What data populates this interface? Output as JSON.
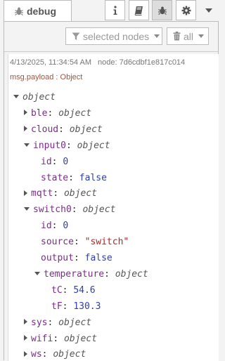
{
  "header": {
    "tab_label": "debug",
    "tab_icon": "bug-icon",
    "buttons": [
      {
        "name": "info-icon"
      },
      {
        "name": "book-icon"
      },
      {
        "name": "bug-icon",
        "active": true
      },
      {
        "name": "gear-icon"
      }
    ]
  },
  "toolbar": {
    "filter_label": "selected nodes",
    "clear_label": "all"
  },
  "message": {
    "timestamp": "4/13/2025, 11:34:54 AM",
    "node": "node: 7d6cdbf1e817c014",
    "topic": "msg.payload : Object",
    "tree": [
      {
        "key": "object",
        "expanded": true
      },
      {
        "key": "ble",
        "type": "object",
        "expanded": false
      },
      {
        "key": "cloud",
        "type": "object",
        "expanded": false
      },
      {
        "key": "input0",
        "type": "object",
        "expanded": true
      },
      {
        "key": "id",
        "value": "0",
        "kind": "num"
      },
      {
        "key": "state",
        "value": "false",
        "kind": "bool"
      },
      {
        "key": "mqtt",
        "type": "object",
        "expanded": false
      },
      {
        "key": "switch0",
        "type": "object",
        "expanded": true
      },
      {
        "key": "id",
        "value": "0",
        "kind": "num"
      },
      {
        "key": "source",
        "value": "\"switch\"",
        "kind": "str"
      },
      {
        "key": "output",
        "value": "false",
        "kind": "bool"
      },
      {
        "key": "temperature",
        "type": "object",
        "expanded": true
      },
      {
        "key": "tC",
        "value": "54.6",
        "kind": "num"
      },
      {
        "key": "tF",
        "value": "130.3",
        "kind": "num"
      },
      {
        "key": "sys",
        "type": "object",
        "expanded": false
      },
      {
        "key": "wifi",
        "type": "object",
        "expanded": false
      },
      {
        "key": "ws",
        "type": "object",
        "expanded": false
      }
    ]
  }
}
